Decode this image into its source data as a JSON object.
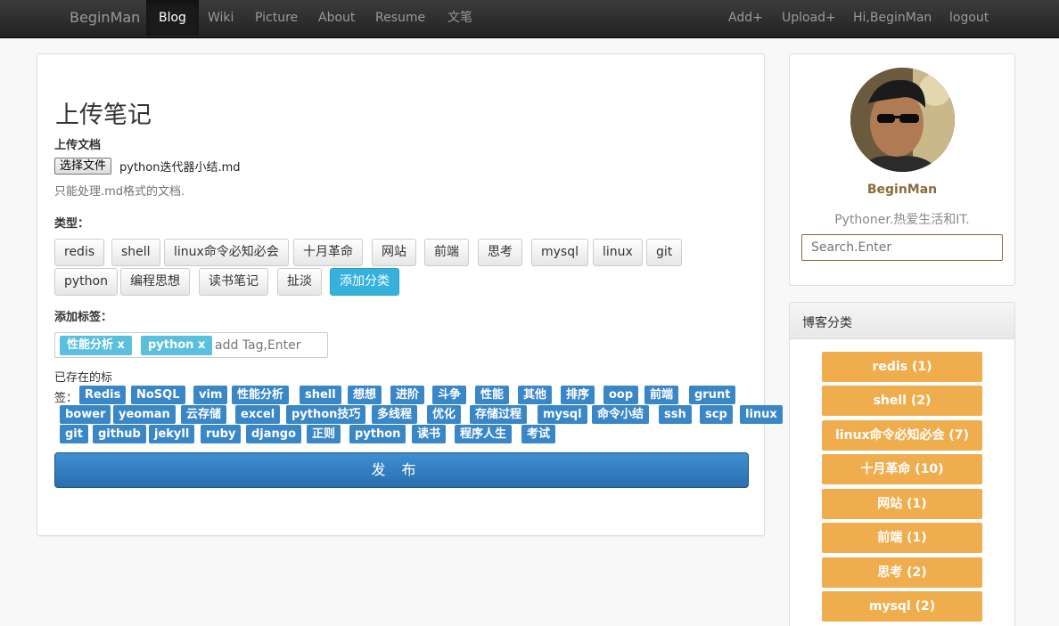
{
  "nav": {
    "brand": "BeginMan",
    "items": [
      {
        "label": "Blog"
      },
      {
        "label": "Wiki"
      },
      {
        "label": "Picture"
      },
      {
        "label": "About"
      },
      {
        "label": "Resume"
      },
      {
        "label": "文笔"
      }
    ],
    "right_items": [
      {
        "label": "Add+"
      },
      {
        "label": "Upload+"
      },
      {
        "label": "Hi,BeginMan"
      },
      {
        "label": "logout"
      }
    ]
  },
  "upload": {
    "title": "上传笔记",
    "doc_label": "上传文档",
    "file_button": "选择文件",
    "file_name": "python迭代器小结.md",
    "help": "只能处理.md格式的文档.",
    "category_label": "类型：",
    "categories": [
      "redis",
      "shell",
      "linux命令必知必会",
      "十月革命",
      "网站",
      "前端",
      "思考",
      "mysql",
      "linux",
      "git",
      "python",
      "编程思想",
      "读书笔记",
      "扯淡"
    ],
    "add_category": "添加分类",
    "tag_label": "添加标签：",
    "chosen_tags": [
      "性能分析 x",
      "python x"
    ],
    "tag_placeholder": "add Tag,Enter",
    "existing_label_1": "已存在的标",
    "existing_label_2": "签：",
    "existing_tags": [
      "Redis",
      "NoSQL",
      "vim",
      "性能分析",
      "shell",
      "想想",
      "进阶",
      "斗争",
      "性能",
      "其他",
      "排序",
      "oop",
      "前端",
      "grunt",
      "bower",
      "yeoman",
      "云存储",
      "excel",
      "python技巧",
      "多线程",
      "优化",
      "存储过程",
      "mysql",
      "命令小结",
      "ssh",
      "scp",
      "linux",
      "git",
      "github",
      "jekyll",
      "ruby",
      "django",
      "正则",
      "python",
      "读书",
      "程序人生",
      "考试"
    ],
    "publish": "发布"
  },
  "profile": {
    "name": "BeginMan",
    "bio": "Pythoner.热爱生活和IT.",
    "search_placeholder": "Search.Enter"
  },
  "sidebar_categories": {
    "title": "博客分类",
    "items": [
      {
        "label": "redis (1)"
      },
      {
        "label": "shell (2)"
      },
      {
        "label": "linux命令必知必会 (7)"
      },
      {
        "label": "十月革命 (10)"
      },
      {
        "label": "网站 (1)"
      },
      {
        "label": "前端 (1)"
      },
      {
        "label": "思考 (2)"
      },
      {
        "label": "mysql (2)"
      }
    ]
  }
}
